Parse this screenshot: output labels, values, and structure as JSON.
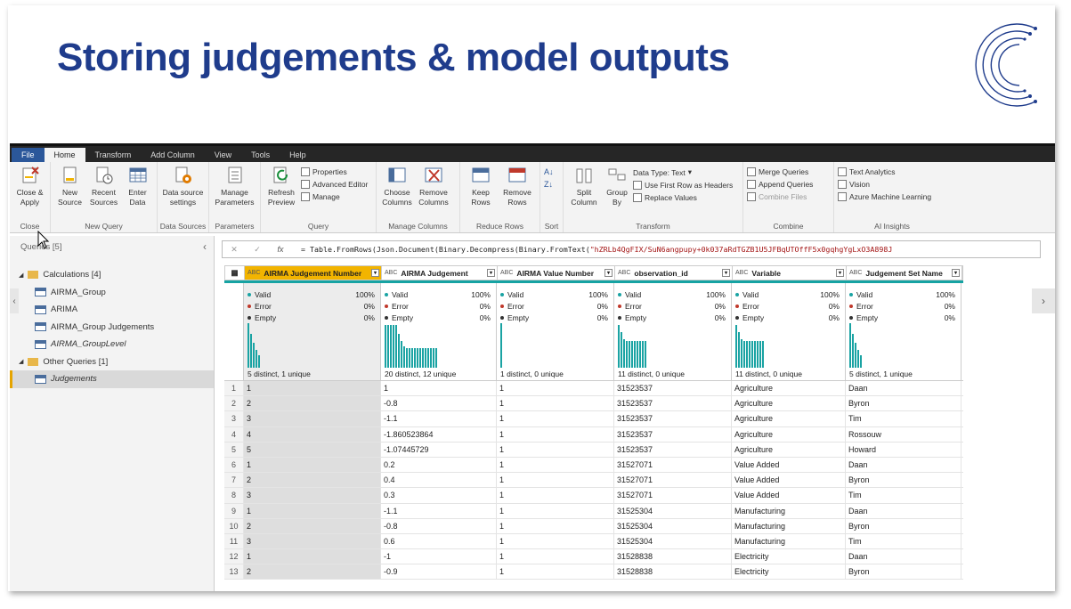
{
  "slide": {
    "title": "Storing judgements & model outputs"
  },
  "menu": [
    "File",
    "Home",
    "Transform",
    "Add Column",
    "View",
    "Tools",
    "Help"
  ],
  "ribbon": {
    "close": {
      "btn": "Close & Apply",
      "label": "Close"
    },
    "newquery": {
      "btns": [
        "New Source",
        "Recent Sources",
        "Enter Data"
      ],
      "label": "New Query"
    },
    "datasources": {
      "btn": "Data source settings",
      "label": "Data Sources"
    },
    "parameters": {
      "btn": "Manage Parameters",
      "label": "Parameters"
    },
    "query": {
      "btn": "Refresh Preview",
      "small": [
        "Properties",
        "Advanced Editor",
        "Manage"
      ],
      "label": "Query"
    },
    "managecols": {
      "btns": [
        "Choose Columns",
        "Remove Columns"
      ],
      "label": "Manage Columns"
    },
    "reducerows": {
      "btns": [
        "Keep Rows",
        "Remove Rows"
      ],
      "label": "Reduce Rows"
    },
    "sort": {
      "label": "Sort"
    },
    "transform": {
      "btns": [
        "Split Column",
        "Group By"
      ],
      "small": [
        "Data Type: Text",
        "Use First Row as Headers",
        "Replace Values"
      ],
      "label": "Transform"
    },
    "combine": {
      "small": [
        "Merge Queries",
        "Append Queries",
        "Combine Files"
      ],
      "label": "Combine"
    },
    "ai": {
      "small": [
        "Text Analytics",
        "Vision",
        "Azure Machine Learning"
      ],
      "label": "AI Insights"
    }
  },
  "queries": {
    "header": "Queries [5]",
    "groups": [
      {
        "name": "Calculations [4]",
        "items": [
          "AIRMA_Group",
          "ARIMA",
          "AIRMA_Group Judgements",
          "AIRMA_GroupLevel"
        ]
      },
      {
        "name": "Other Queries [1]",
        "items": [
          "Judgements"
        ]
      }
    ]
  },
  "formula": {
    "prefix": "= Table.FromRows(Json.Document(Binary.Decompress(Binary.FromText(",
    "string": "\"hZRLb4QgFIX/SuN6angpupy+0k037aRdTGZB1U5JFBqUTOffF5x0gqhgYgLxO3A898J"
  },
  "columns": [
    {
      "name": "AIRMA Judgement Number",
      "valid": "100%",
      "error": "0%",
      "empty": "0%",
      "dist": "5 distinct, 1 unique"
    },
    {
      "name": "AIRMA Judgement",
      "valid": "100%",
      "error": "0%",
      "empty": "0%",
      "dist": "20 distinct, 12 unique"
    },
    {
      "name": "AIRMA Value Number",
      "valid": "100%",
      "error": "0%",
      "empty": "0%",
      "dist": "1 distinct, 0 unique"
    },
    {
      "name": "observation_id",
      "valid": "100%",
      "error": "0%",
      "empty": "0%",
      "dist": "11 distinct, 0 unique"
    },
    {
      "name": "Variable",
      "valid": "100%",
      "error": "0%",
      "empty": "0%",
      "dist": "11 distinct, 0 unique"
    },
    {
      "name": "Judgement Set Name",
      "valid": "100%",
      "error": "0%",
      "empty": "0%",
      "dist": "5 distinct, 1 unique"
    }
  ],
  "labels": {
    "valid": "Valid",
    "error": "Error",
    "empty": "Empty"
  },
  "rows": [
    [
      "1",
      "1",
      "1",
      "1",
      "31523537",
      "Agriculture",
      "Daan"
    ],
    [
      "2",
      "2",
      "-0.8",
      "1",
      "31523537",
      "Agriculture",
      "Byron"
    ],
    [
      "3",
      "3",
      "-1.1",
      "1",
      "31523537",
      "Agriculture",
      "Tim"
    ],
    [
      "4",
      "4",
      "-1.860523864",
      "1",
      "31523537",
      "Agriculture",
      "Rossouw"
    ],
    [
      "5",
      "5",
      "-1.07445729",
      "1",
      "31523537",
      "Agriculture",
      "Howard"
    ],
    [
      "6",
      "1",
      "0.2",
      "1",
      "31527071",
      "Value Added",
      "Daan"
    ],
    [
      "7",
      "2",
      "0.4",
      "1",
      "31527071",
      "Value Added",
      "Byron"
    ],
    [
      "8",
      "3",
      "0.3",
      "1",
      "31527071",
      "Value Added",
      "Tim"
    ],
    [
      "9",
      "1",
      "-1.1",
      "1",
      "31525304",
      "Manufacturing",
      "Daan"
    ],
    [
      "10",
      "2",
      "-0.8",
      "1",
      "31525304",
      "Manufacturing",
      "Byron"
    ],
    [
      "11",
      "3",
      "0.6",
      "1",
      "31525304",
      "Manufacturing",
      "Tim"
    ],
    [
      "12",
      "1",
      "-1",
      "1",
      "31528838",
      "Electricity",
      "Daan"
    ],
    [
      "13",
      "2",
      "-0.9",
      "1",
      "31528838",
      "Electricity",
      "Byron"
    ]
  ]
}
